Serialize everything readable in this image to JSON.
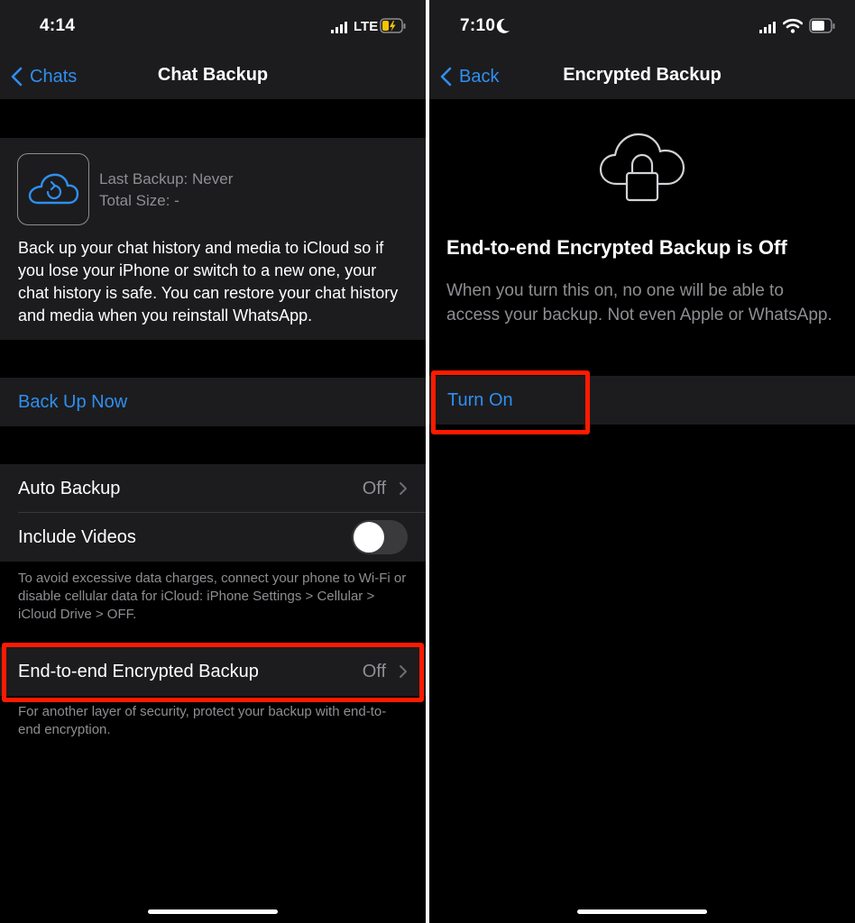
{
  "left": {
    "status": {
      "time": "4:14",
      "network": "LTE"
    },
    "nav": {
      "back_label": "Chats",
      "title": "Chat Backup"
    },
    "backup_info": {
      "last_backup": "Last Backup: Never",
      "total_size": "Total Size: -",
      "description": "Back up your chat history and media to iCloud so if you lose your iPhone or switch to a new one, your chat history is safe. You can restore your chat history and media when you reinstall WhatsApp."
    },
    "back_up_now": "Back Up Now",
    "auto_backup": {
      "label": "Auto Backup",
      "value": "Off"
    },
    "include_videos": {
      "label": "Include Videos",
      "enabled": false
    },
    "data_note": "To avoid excessive data charges, connect your phone to Wi-Fi or disable cellular data for iCloud: iPhone Settings > Cellular > iCloud Drive > OFF.",
    "e2e_backup": {
      "label": "End-to-end Encrypted Backup",
      "value": "Off"
    },
    "e2e_note": "For another layer of security, protect your backup with end-to-end encryption."
  },
  "right": {
    "status": {
      "time": "7:10"
    },
    "nav": {
      "back_label": "Back",
      "title": "Encrypted Backup"
    },
    "heading": "End-to-end Encrypted Backup is Off",
    "description": "When you turn this on, no one will be able to access your backup. Not even Apple or WhatsApp.",
    "turn_on": "Turn On"
  },
  "colors": {
    "accent": "#2f8ff0",
    "highlight": "#ff1a00",
    "cell_bg": "#1c1c1e",
    "secondary_text": "#8e8e93"
  }
}
